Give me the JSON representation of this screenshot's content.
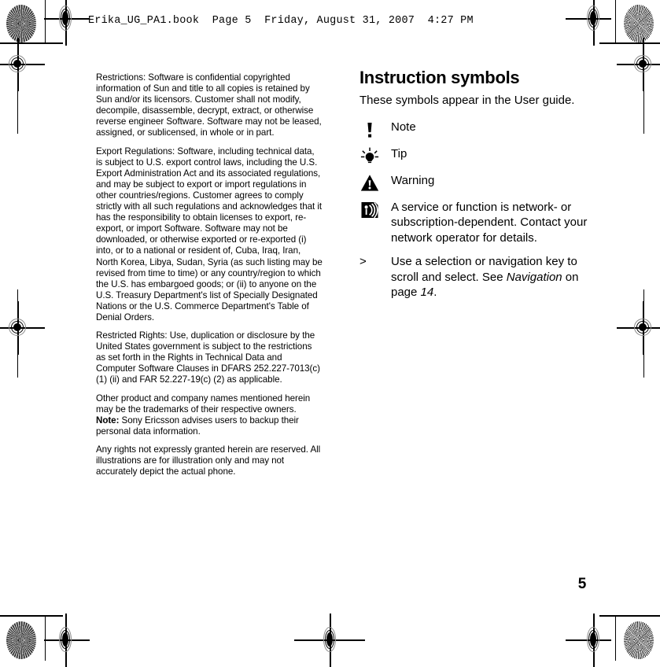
{
  "header": {
    "file_line": "Erika_UG_PA1.book  Page 5  Friday, August 31, 2007  4:27 PM"
  },
  "left_column": {
    "paragraphs": [
      {
        "id": "restrictions",
        "text": "Restrictions: Software is confidential copyrighted information of Sun and title to all copies is retained by Sun and/or its licensors. Customer shall not modify, decompile, disassemble, decrypt, extract, or otherwise reverse engineer Software. Software may not be leased, assigned, or sublicensed, in whole or in part."
      },
      {
        "id": "export-regulations",
        "text": "Export Regulations: Software, including technical data, is subject to U.S. export control laws, including the U.S. Export Administration Act and its associated regulations, and may be subject to export or import regulations in other countries/regions. Customer agrees to comply strictly with all such regulations and acknowledges that it has the responsibility to obtain licenses to export, re-export, or import Software. Software may not be downloaded, or otherwise exported or re-exported (i) into, or to a national or resident of, Cuba, Iraq, Iran, North Korea, Libya, Sudan, Syria (as such listing may be revised from time to time) or any country/region to which the U.S. has embargoed goods; or (ii) to anyone on the U.S. Treasury Department's list of Specially Designated Nations or the U.S. Commerce Department's Table of Denial Orders."
      },
      {
        "id": "restricted-rights",
        "text": "Restricted Rights: Use, duplication or disclosure by the United States government is subject to the restrictions as set forth in the Rights in Technical Data and Computer Software Clauses in DFARS 252.227-7013(c) (1) (ii) and FAR 52.227-19(c) (2) as applicable."
      },
      {
        "id": "trademarks",
        "text": "Other product and company names mentioned herein may be the trademarks of their respective owners."
      },
      {
        "id": "note-backup",
        "bold_lead": "Note:",
        "text": " Sony Ericsson advises users to backup their personal data information."
      },
      {
        "id": "rights-reserved",
        "text": "Any rights not expressly granted herein are reserved. All illustrations are for illustration only and may not accurately depict the actual phone."
      }
    ]
  },
  "right_column": {
    "title": "Instruction symbols",
    "intro": "These symbols appear in the User guide.",
    "symbols": [
      {
        "icon": "exclamation-note-icon",
        "label": "Note"
      },
      {
        "icon": "lightbulb-tip-icon",
        "label": "Tip"
      },
      {
        "icon": "warning-triangle-icon",
        "label": "Warning"
      },
      {
        "icon": "network-signal-icon",
        "label": "A service or function is network- or subscription-dependent. Contact your network operator for details."
      }
    ],
    "navigation_entry": {
      "marker": ">",
      "text_before": "Use a selection or navigation key to scroll and select. See ",
      "italic_term": "Navigation",
      "text_middle": " on page ",
      "italic_page": "14",
      "text_after": "."
    }
  },
  "footer": {
    "page_number": "5"
  },
  "colors": {
    "text": "#000000",
    "background": "#ffffff",
    "registration_ring": "#8a8a8a"
  }
}
